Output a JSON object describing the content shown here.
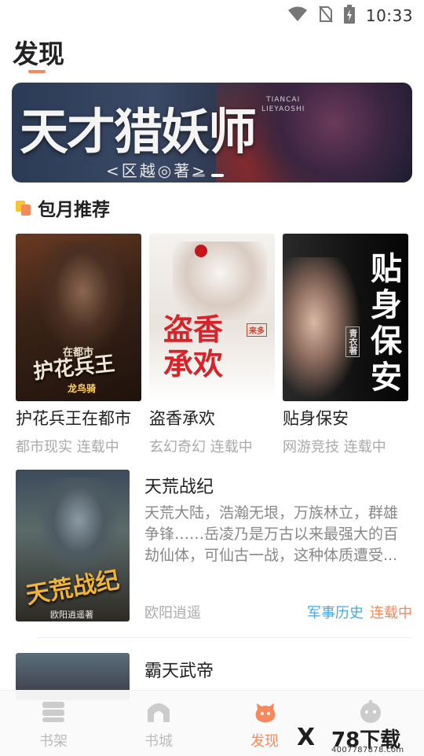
{
  "status_bar": {
    "time": "10:33",
    "icons": [
      "wifi-icon",
      "no-sim-icon",
      "battery-charging-icon"
    ]
  },
  "page": {
    "title": "发现"
  },
  "banner": {
    "title": "天才猎妖师",
    "author": "<区越◎著>",
    "pinyin_line1": "TIANCAI",
    "pinyin_line2": "LIEYAOSHI",
    "active_slide": 2,
    "slide_count": 2
  },
  "section": {
    "title": "包月推荐"
  },
  "monthly_books": [
    {
      "title": "护花兵王在都市",
      "category": "都市现实",
      "status": "连载中",
      "cover_title": "护花兵王",
      "cover_subtitle": "在都市",
      "cover_author": "龙鸟骑"
    },
    {
      "title": "盗香承欢",
      "category": "玄幻奇幻",
      "status": "连载中",
      "cover_title": "盗香承欢",
      "cover_author": "来多"
    },
    {
      "title": "贴身保安",
      "category": "网游竞技",
      "status": "连载中",
      "cover_title": "贴身保安",
      "cover_author": "青衣著"
    }
  ],
  "book_list": [
    {
      "title": "天荒战纪",
      "description": "天荒大陆，浩瀚无垠，万族林立，群雄争锋……岳凌乃是万古以来最强大的百劫仙体，可仙古一战，这种体质遭受...",
      "author": "欧阳逍遥",
      "category": "军事历史",
      "status": "连载中",
      "cover_title": "天荒战纪",
      "cover_author": "欧阳逍遥著"
    },
    {
      "title": "霸天武帝"
    }
  ],
  "bottom_nav": [
    {
      "label": "书架",
      "icon": "bookshelf-icon",
      "active": false
    },
    {
      "label": "书城",
      "icon": "bookstore-icon",
      "active": false
    },
    {
      "label": "发现",
      "icon": "discover-icon",
      "active": true
    },
    {
      "label": "",
      "icon": "profile-icon",
      "active": false
    }
  ],
  "watermark": {
    "logo": "X",
    "name": "78下载",
    "url": "4007787878.com"
  },
  "colors": {
    "accent": "#f5895c",
    "category_blue": "#4aa8e0",
    "meta_gray": "#aaaaaa"
  }
}
